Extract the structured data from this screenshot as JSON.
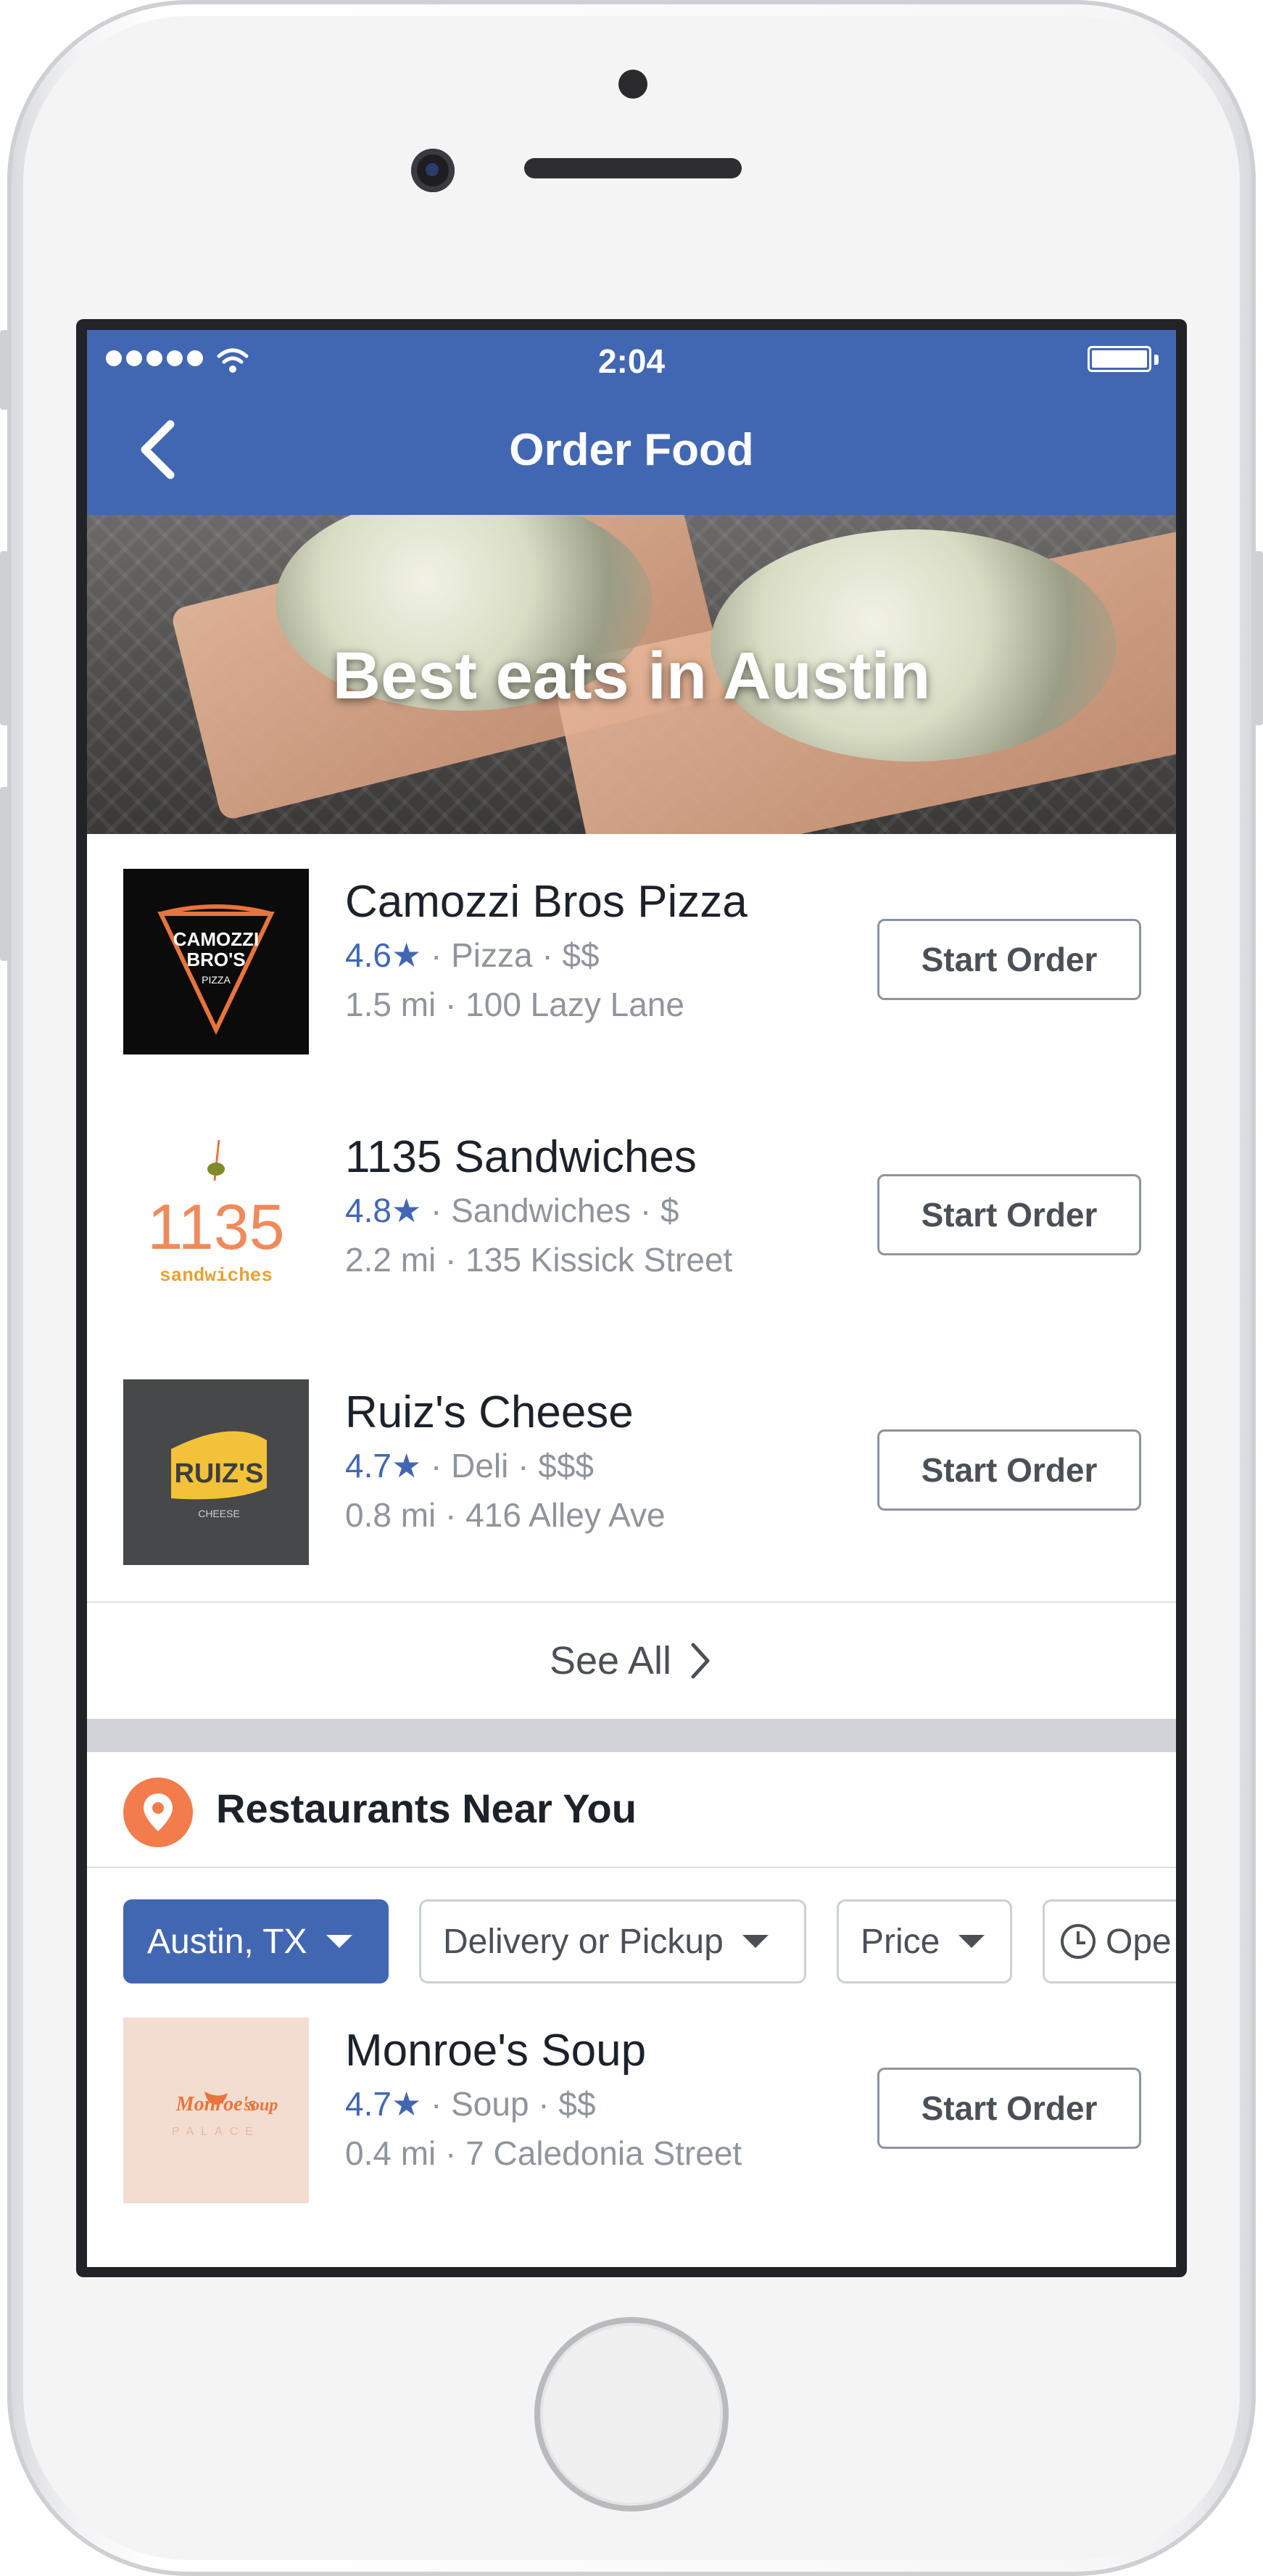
{
  "status_bar": {
    "time": "2:04"
  },
  "nav": {
    "title": "Order Food"
  },
  "hero": {
    "title": "Best eats in Austin"
  },
  "featured": [
    {
      "name": "Camozzi Bros Pizza",
      "rating": "4.6",
      "category": "Pizza",
      "price": "$$",
      "distance": "1.5 mi",
      "address": "100 Lazy Lane",
      "button": "Start Order",
      "logo_text": {
        "line1": "CAMOZZI",
        "line2": "BRO'S",
        "line3": "PIZZA"
      }
    },
    {
      "name": "1135 Sandwiches",
      "rating": "4.8",
      "category": "Sandwiches",
      "price": "$",
      "distance": "2.2 mi",
      "address": "135 Kissick Street",
      "button": "Start Order",
      "logo_text": {
        "big": "1135",
        "small": "sandwiches"
      }
    },
    {
      "name": "Ruiz's Cheese",
      "rating": "4.7",
      "category": "Deli",
      "price": "$$$",
      "distance": "0.8 mi",
      "address": " 416 Alley Ave",
      "button": "Start Order",
      "logo_text": {
        "big": "RUIZ'S",
        "small": "CHEESE"
      }
    }
  ],
  "see_all": "See All",
  "near_you": {
    "title": "Restaurants Near You"
  },
  "filters": {
    "location": "Austin, TX",
    "mode": "Delivery or Pickup",
    "price": "Price",
    "open": "Ope"
  },
  "nearby": [
    {
      "name": "Monroe's Soup",
      "rating": "4.7",
      "category": "Soup",
      "price": "$$",
      "distance": "0.4 mi",
      "address": "7 Caledonia Street",
      "button": "Start Order",
      "logo_text": {
        "line1": "Monroe's",
        "line2": "soup",
        "line3": "PALACE"
      }
    }
  ],
  "colors": {
    "brand_blue": "#4267b2",
    "pin_orange": "#f27c4b"
  }
}
